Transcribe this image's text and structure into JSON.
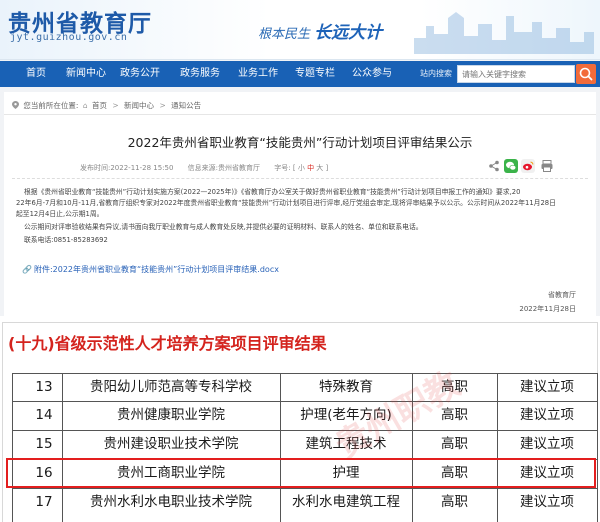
{
  "site": {
    "title": "贵州省教育厅",
    "url": "jyt.guizhou.gov.cn",
    "slogan_a": "根本民生",
    "slogan_b": "长远大计"
  },
  "nav": {
    "items": [
      "首页",
      "新闻中心",
      "政务公开",
      "政务服务",
      "业务工作",
      "专题专栏",
      "公众参与"
    ],
    "search_label": "站内搜索",
    "search_placeholder": "请输入关键字搜索"
  },
  "breadcrumb": {
    "prefix": "您当前所在位置:",
    "items": [
      "首页",
      "新闻中心",
      "通知公告"
    ],
    "sep": ">"
  },
  "article": {
    "title": "2022年贵州省职业教育“技能贵州”行动计划项目评审结果公示",
    "date": "发布时间:2022-11-28 15:50",
    "source": "信息来源:贵州省教育厅",
    "font_label": "字号:",
    "font_sizes": [
      "小",
      "中",
      "大"
    ],
    "paragraphs": [
      "根据《贵州省职业教育“技能贵州”行动计划实施方案(2022—2025年)》《省教育厅办公室关于做好贵州省职业教育“技能贵州”行动计划项目申报工作的通知》要求,20",
      "22年6月-7月和10月-11月,省教育厅组织专家对2022年度贵州省职业教育“技能贵州”行动计划项目进行评审,经厅党组会审定,现将评审结果予以公示。公示时间从2022年11月28日",
      "起至12月4日止,公示期1周。",
      "公示期间对评审验收结果有异议,请书面向我厅职业教育与成人教育处反映,并提供必要的证明材料、联系人的姓名、单位和联系电话。",
      "联系电话:0851-85283692"
    ],
    "attachment": "附件:2022年贵州省职业教育“技能贵州”行动计划项目评审结果.docx",
    "signature": "省教育厅",
    "sign_date": "2022年11月28日"
  },
  "sheet": {
    "title": "(十九)省级示范性人才培养方案项目评审结果",
    "watermark": "贵州职教",
    "rows": [
      {
        "no": "13",
        "school": "贵阳幼儿师范高等专科学校",
        "major": "特殊教育",
        "level": "高职",
        "result": "建议立项"
      },
      {
        "no": "14",
        "school": "贵州健康职业学院",
        "major": "护理(老年方向)",
        "level": "高职",
        "result": "建议立项"
      },
      {
        "no": "15",
        "school": "贵州建设职业技术学院",
        "major": "建筑工程技术",
        "level": "高职",
        "result": "建议立项"
      },
      {
        "no": "16",
        "school": "贵州工商职业学院",
        "major": "护理",
        "level": "高职",
        "result": "建议立项"
      },
      {
        "no": "17",
        "school": "贵州水利水电职业技术学院",
        "major": "水利水电建筑工程",
        "level": "高职",
        "result": "建议立项"
      }
    ],
    "highlight_color": "#e31e1e"
  },
  "colors": {
    "brand_blue": "#1961b5",
    "accent_red": "#d4231d",
    "search_orange": "#f26b3a"
  }
}
